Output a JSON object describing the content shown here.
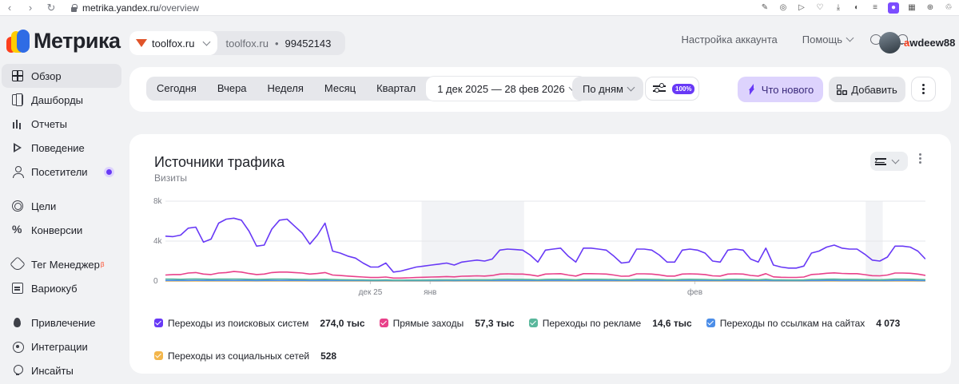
{
  "browser": {
    "url_host": "metrika.yandex.ru",
    "url_path": "/overview"
  },
  "header": {
    "logo": "Метрика",
    "counter_site": "toolfox.ru",
    "counter_name": "toolfox.ru",
    "counter_id": "99452143",
    "account_settings": "Настройка аккаунта",
    "help": "Помощь",
    "user_first": "a",
    "user_rest": "wdeew88"
  },
  "sidebar": {
    "items": [
      {
        "label": "Обзор"
      },
      {
        "label": "Дашборды"
      },
      {
        "label": "Отчеты"
      },
      {
        "label": "Поведение"
      },
      {
        "label": "Посетители"
      },
      {
        "label": "Цели"
      },
      {
        "label": "Конверсии"
      },
      {
        "label": "Тег Менеджер",
        "sup": "β"
      },
      {
        "label": "Вариокуб"
      },
      {
        "label": "Привлечение"
      },
      {
        "label": "Интеграции"
      },
      {
        "label": "Инсайты"
      }
    ]
  },
  "filters": {
    "periods": [
      "Сегодня",
      "Вчера",
      "Неделя",
      "Месяц",
      "Квартал"
    ],
    "date_range": "1 дек 2025 — 28 фев 2026",
    "group_by": "По дням",
    "sampling": "100%",
    "whats_new": "Что нового",
    "add": "Добавить"
  },
  "widget": {
    "title": "Источники трафика",
    "subtitle": "Визиты"
  },
  "colors": {
    "search": "#6839f6",
    "direct": "#e8418a",
    "ads": "#5ab79c",
    "links": "#4c8ee8",
    "social": "#f3b64b"
  },
  "chart_data": {
    "type": "line",
    "ylim": [
      0,
      8000
    ],
    "yticks": [
      "8k",
      "4k",
      "0"
    ],
    "xticks": [
      "дек 25",
      "янв",
      "фев"
    ],
    "x_start": "2025-12-01",
    "x_end": "2026-02-28",
    "shaded_ranges": [
      [
        "2025-12-31",
        "2026-01-11"
      ],
      [
        "2026-02-21",
        "2026-02-22"
      ]
    ],
    "series": [
      {
        "name": "Переходы из поисковых систем",
        "color": "#6839f6",
        "total": "274,0 тыс",
        "values": [
          4500,
          4450,
          4600,
          5300,
          5400,
          3900,
          4200,
          5800,
          6200,
          6300,
          6100,
          5000,
          3500,
          3600,
          5200,
          6100,
          6200,
          5500,
          4800,
          3700,
          4600,
          5800,
          3000,
          2800,
          2500,
          2300,
          1800,
          1400,
          1400,
          1800,
          900,
          1000,
          1200,
          1400,
          1500,
          1600,
          1700,
          1800,
          1600,
          1900,
          2000,
          2100,
          2000,
          2200,
          3100,
          3200,
          3150,
          3100,
          2600,
          1900,
          3100,
          3200,
          3300,
          2500,
          1900,
          3300,
          3300,
          3200,
          3100,
          2500,
          1800,
          1900,
          3200,
          3200,
          3100,
          2600,
          1900,
          1900,
          3100,
          3200,
          3100,
          2800,
          2000,
          1900,
          3100,
          3200,
          3100,
          2200,
          1900,
          3300,
          1600,
          1400,
          1300,
          1300,
          1500,
          2800,
          3000,
          3400,
          3600,
          3300,
          3200,
          3200,
          2700,
          2100,
          2000,
          2400,
          3500,
          3500,
          3400,
          3000,
          2200
        ]
      },
      {
        "name": "Прямые заходы",
        "color": "#e8418a",
        "total": "57,3 тыс",
        "values": [
          600,
          650,
          650,
          800,
          850,
          700,
          650,
          800,
          850,
          950,
          900,
          750,
          650,
          700,
          850,
          900,
          900,
          850,
          800,
          700,
          750,
          850,
          600,
          550,
          500,
          450,
          400,
          350,
          350,
          400,
          300,
          300,
          320,
          350,
          380,
          400,
          420,
          450,
          420,
          480,
          500,
          520,
          500,
          550,
          700,
          720,
          700,
          700,
          620,
          500,
          700,
          720,
          740,
          600,
          500,
          740,
          740,
          720,
          700,
          600,
          480,
          500,
          720,
          720,
          700,
          620,
          500,
          500,
          700,
          720,
          700,
          650,
          520,
          500,
          700,
          720,
          700,
          560,
          500,
          740,
          420,
          380,
          360,
          360,
          400,
          650,
          700,
          780,
          820,
          760,
          740,
          740,
          640,
          540,
          520,
          600,
          800,
          800,
          780,
          700,
          560
        ]
      },
      {
        "name": "Переходы по рекламе",
        "color": "#5ab79c",
        "total": "14,6 тыс",
        "values": [
          200,
          190,
          180,
          200,
          210,
          190,
          180,
          200,
          190,
          200,
          190,
          180,
          170,
          180,
          190,
          200,
          190,
          180,
          170,
          160,
          170,
          180,
          150,
          140,
          130,
          120,
          110,
          100,
          100,
          110,
          90,
          90,
          95,
          100,
          100,
          105,
          110,
          115,
          110,
          120,
          125,
          130,
          125,
          135,
          170,
          175,
          170,
          170,
          155,
          130,
          170,
          175,
          180,
          150,
          130,
          180,
          180,
          175,
          170,
          150,
          125,
          130,
          175,
          175,
          170,
          155,
          130,
          130,
          170,
          175,
          170,
          160,
          135,
          130,
          170,
          175,
          170,
          145,
          130,
          180,
          115,
          110,
          105,
          105,
          110,
          160,
          170,
          185,
          195,
          180,
          175,
          175,
          155,
          135,
          130,
          150,
          190,
          190,
          185,
          170,
          140
        ]
      },
      {
        "name": "Переходы по ссылкам на сайтах",
        "color": "#4c8ee8",
        "total": "4 073",
        "values": [
          60,
          55,
          55,
          60,
          62,
          55,
          52,
          58,
          56,
          60,
          58,
          54,
          50,
          52,
          56,
          58,
          56,
          54,
          52,
          48,
          50,
          54,
          44,
          42,
          40,
          38,
          36,
          34,
          34,
          36,
          30,
          30,
          31,
          32,
          33,
          34,
          35,
          36,
          35,
          37,
          38,
          39,
          38,
          40,
          48,
          50,
          48,
          48,
          45,
          40,
          48,
          50,
          51,
          44,
          40,
          51,
          51,
          50,
          48,
          44,
          38,
          40,
          50,
          50,
          48,
          45,
          40,
          40,
          48,
          50,
          48,
          46,
          41,
          40,
          48,
          50,
          48,
          43,
          40,
          51,
          35,
          34,
          33,
          33,
          34,
          46,
          48,
          52,
          54,
          51,
          50,
          50,
          45,
          41,
          40,
          44,
          53,
          53,
          52,
          48,
          42
        ]
      },
      {
        "name": "Переходы из социальных сетей",
        "color": "#f3b64b",
        "total": "528",
        "values": [
          8,
          8,
          7,
          8,
          8,
          7,
          7,
          8,
          7,
          8,
          7,
          7,
          6,
          7,
          7,
          8,
          7,
          7,
          7,
          6,
          7,
          7,
          6,
          5,
          5,
          5,
          4,
          4,
          4,
          4,
          4,
          4,
          4,
          4,
          4,
          4,
          4,
          5,
          4,
          5,
          5,
          5,
          5,
          5,
          6,
          6,
          6,
          6,
          6,
          5,
          6,
          6,
          6,
          6,
          5,
          6,
          6,
          6,
          6,
          6,
          5,
          5,
          6,
          6,
          6,
          6,
          5,
          5,
          6,
          6,
          6,
          6,
          5,
          5,
          6,
          6,
          6,
          5,
          5,
          6,
          4,
          4,
          4,
          4,
          4,
          6,
          6,
          7,
          7,
          6,
          6,
          6,
          6,
          5,
          5,
          5,
          7,
          7,
          7,
          6,
          5
        ]
      }
    ]
  }
}
